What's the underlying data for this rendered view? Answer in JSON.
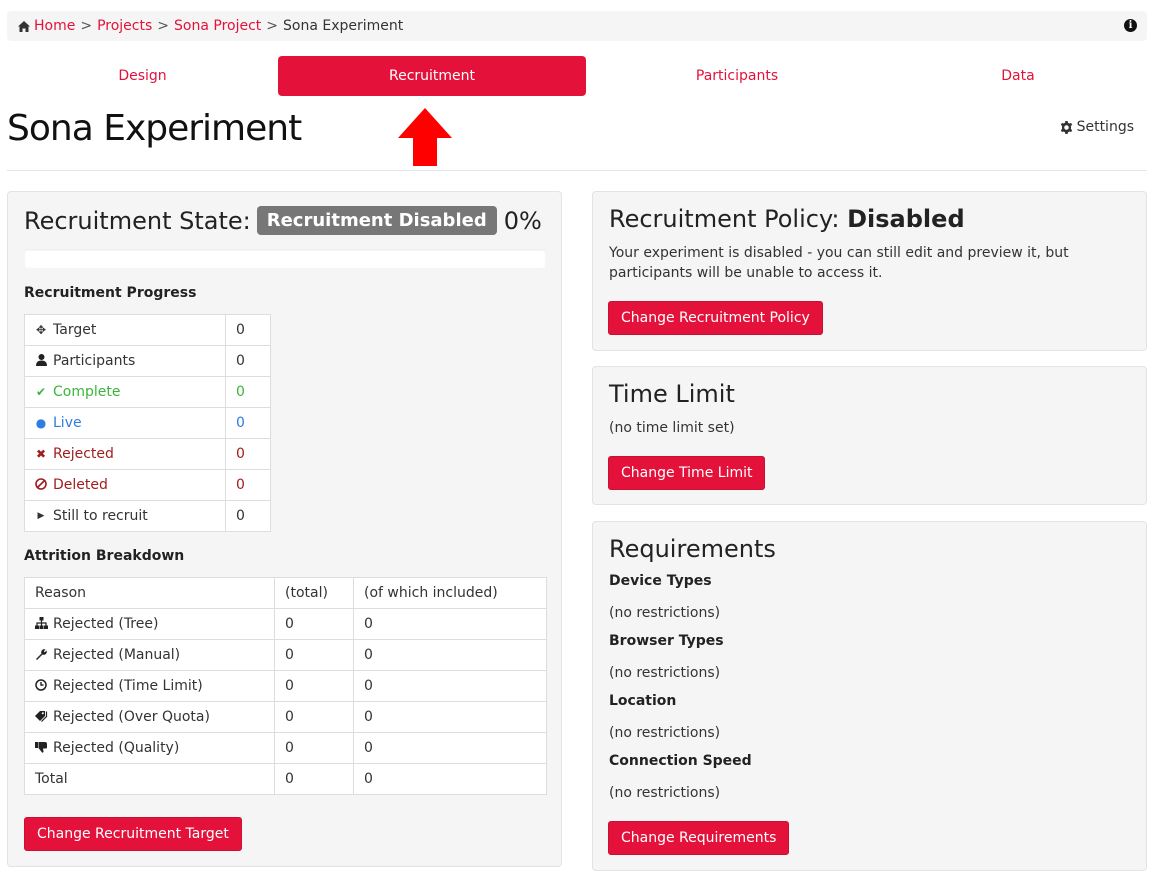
{
  "breadcrumb": {
    "home": "Home",
    "projects": "Projects",
    "project": "Sona Project",
    "current": "Sona Experiment",
    "separator": ">"
  },
  "tabs": [
    {
      "label": "Design",
      "active": false
    },
    {
      "label": "Recruitment",
      "active": true
    },
    {
      "label": "Participants",
      "active": false
    },
    {
      "label": "Data",
      "active": false
    }
  ],
  "page_title": "Sona Experiment",
  "settings_label": "Settings",
  "recruitment_state": {
    "label": "Recruitment State:",
    "badge": "Recruitment Disabled",
    "percent": "0%"
  },
  "progress": {
    "title": "Recruitment Progress",
    "rows": [
      {
        "icon": "crosshairs-icon",
        "label": "Target",
        "value": "0"
      },
      {
        "icon": "user-icon",
        "label": "Participants",
        "value": "0"
      },
      {
        "icon": "check-icon",
        "label": "Complete",
        "value": "0"
      },
      {
        "icon": "circle-icon",
        "label": "Live",
        "value": "0"
      },
      {
        "icon": "times-icon",
        "label": "Rejected",
        "value": "0"
      },
      {
        "icon": "ban-icon",
        "label": "Deleted",
        "value": "0"
      },
      {
        "icon": "caret-right-icon",
        "label": "Still to recruit",
        "value": "0"
      }
    ]
  },
  "attrition": {
    "title": "Attrition Breakdown",
    "headers": [
      "Reason",
      "(total)",
      "(of which included)"
    ],
    "rows": [
      {
        "icon": "sitemap-icon",
        "label": "Rejected (Tree)",
        "total": "0",
        "included": "0"
      },
      {
        "icon": "wrench-icon",
        "label": "Rejected (Manual)",
        "total": "0",
        "included": "0"
      },
      {
        "icon": "clock-icon",
        "label": "Rejected (Time Limit)",
        "total": "0",
        "included": "0"
      },
      {
        "icon": "tags-icon",
        "label": "Rejected (Over Quota)",
        "total": "0",
        "included": "0"
      },
      {
        "icon": "thumbs-down-icon",
        "label": "Rejected (Quality)",
        "total": "0",
        "included": "0"
      },
      {
        "icon": "",
        "label": "Total",
        "total": "0",
        "included": "0"
      }
    ]
  },
  "change_target_button": "Change Recruitment Target",
  "policy": {
    "heading": "Recruitment Policy:",
    "status": "Disabled",
    "description": "Your experiment is disabled - you can still edit and preview it, but participants will be unable to access it.",
    "button": "Change Recruitment Policy"
  },
  "time_limit": {
    "heading": "Time Limit",
    "value": "(no time limit set)",
    "button": "Change Time Limit"
  },
  "requirements": {
    "heading": "Requirements",
    "items": [
      {
        "label": "Device Types",
        "value": "(no restrictions)"
      },
      {
        "label": "Browser Types",
        "value": "(no restrictions)"
      },
      {
        "label": "Location",
        "value": "(no restrictions)"
      },
      {
        "label": "Connection Speed",
        "value": "(no restrictions)"
      }
    ],
    "button": "Change Requirements"
  },
  "colors": {
    "brand": "#e4123a",
    "badge_grey": "#777777",
    "complete_green": "#3ab53a",
    "live_blue": "#2e7de0",
    "rejected_red": "#a01e1e"
  }
}
